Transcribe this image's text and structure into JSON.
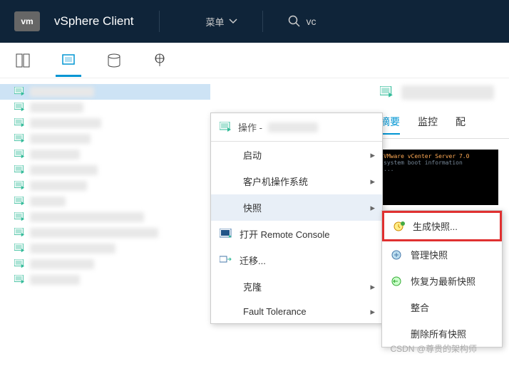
{
  "header": {
    "logo": "vm",
    "title": "vSphere Client",
    "menu_label": "菜单",
    "search_value": "vc"
  },
  "context_menu": {
    "header": "操作 -",
    "items": {
      "start": "启动",
      "guest_os": "客户机操作系统",
      "snapshot": "快照",
      "remote_console": "打开 Remote Console",
      "migrate": "迁移...",
      "clone": "克隆",
      "fault_tolerance": "Fault Tolerance"
    }
  },
  "submenu": {
    "create": "生成快照...",
    "manage": "管理快照",
    "revert": "恢复为最新快照",
    "consolidate": "整合",
    "delete_all": "删除所有快照"
  },
  "tabs": {
    "summary": "摘要",
    "monitor": "监控",
    "config": "配"
  },
  "watermark": "CSDN @尊贵的架构师"
}
